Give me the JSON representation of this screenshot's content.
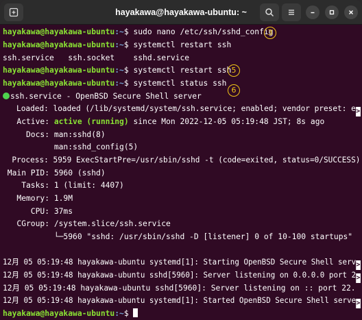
{
  "window": {
    "title": "hayakawa@hayakawa-ubuntu: ~"
  },
  "icons": {
    "new_tab": "new-tab-icon",
    "search": "search-icon",
    "menu": "hamburger-menu-icon",
    "minimize": "minimize-icon",
    "maximize": "maximize-icon",
    "close": "close-icon"
  },
  "prompt": {
    "user": "hayakawa@hayakawa-ubuntu",
    "path": ":~",
    "symbol": "$ "
  },
  "lines": {
    "cmd1": "sudo nano /etc/ssh/sshd_config",
    "cmd2": "systemctl restart ssh",
    "completion": "ssh.service   ssh.socket    sshd.service",
    "cmd3": "systemctl restart ssh",
    "cmd4": "systemctl status ssh",
    "service_header": "ssh.service - OpenBSD Secure Shell server",
    "loaded": "   Loaded: loaded (/lib/systemd/system/ssh.service; enabled; vendor preset: e",
    "active_label": "   Active: ",
    "active_state": "active (running)",
    "active_rest": " since Mon 2022-12-05 05:19:48 JST; 8s ago",
    "docs": "     Docs: man:sshd(8)",
    "docs2": "           man:sshd_config(5)",
    "process": "  Process: 5959 ExecStartPre=/usr/sbin/sshd -t (code=exited, status=0/SUCCESS)",
    "main_pid": " Main PID: 5960 (sshd)",
    "tasks": "    Tasks: 1 (limit: 4407)",
    "memory": "   Memory: 1.9M",
    "cpu": "      CPU: 37ms",
    "cgroup": "   CGroup: /system.slice/ssh.service",
    "cgroup_child": "           └─5960 \"sshd: /usr/sbin/sshd -D [listener] 0 of 10-100 startups\"",
    "log1": "12月 05 05:19:48 hayakawa-ubuntu systemd[1]: Starting OpenBSD Secure Shell serv",
    "log2": "12月 05 05:19:48 hayakawa-ubuntu sshd[5960]: Server listening on 0.0.0.0 port 2",
    "log3": "12月 05 05:19:48 hayakawa-ubuntu sshd[5960]: Server listening on :: port 22.",
    "log4": "12月 05 05:19:48 hayakawa-ubuntu systemd[1]: Started OpenBSD Secure Shell serve"
  },
  "truncation_marker": ">",
  "annotations": {
    "a3": "3",
    "a5": "5",
    "a6": "6"
  },
  "colors": {
    "terminal_bg": "#300a24",
    "prompt_user": "#8ae234",
    "prompt_path": "#729fcf",
    "annotation": "#f0c419",
    "status_dot": "#4ed34e"
  }
}
